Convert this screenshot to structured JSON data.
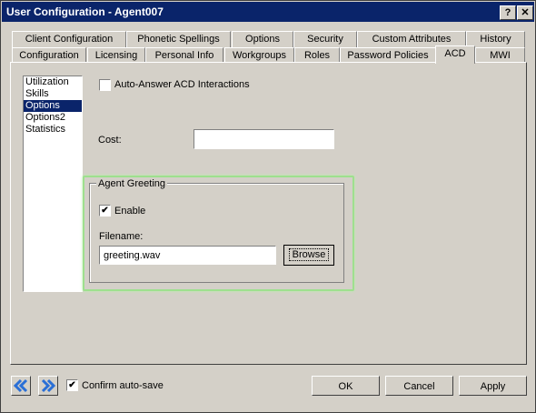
{
  "window": {
    "title": "User Configuration - Agent007",
    "help_label": "?",
    "close_label": "✕"
  },
  "tabs_row1": [
    "Client Configuration",
    "Phonetic Spellings",
    "Options",
    "Security",
    "Custom Attributes",
    "History"
  ],
  "tabs_row2": [
    "Configuration",
    "Licensing",
    "Personal Info",
    "Workgroups",
    "Roles",
    "Password Policies",
    "ACD",
    "MWI"
  ],
  "active_tab": "ACD",
  "sidebar": {
    "items": [
      "Utilization",
      "Skills",
      "Options",
      "Options2",
      "Statistics"
    ],
    "selected": "Options"
  },
  "acd_options": {
    "auto_answer_label": "Auto-Answer ACD Interactions",
    "auto_answer_checked": false,
    "cost_label": "Cost:",
    "cost_value": ""
  },
  "agent_greeting": {
    "group_label": "Agent Greeting",
    "enable_label": "Enable",
    "enable_checked": true,
    "filename_label": "Filename:",
    "filename_value": "greeting.wav",
    "browse_label": "Browse"
  },
  "footer": {
    "confirm_label": "Confirm auto-save",
    "confirm_checked": true,
    "ok_label": "OK",
    "cancel_label": "Cancel",
    "apply_label": "Apply"
  },
  "colors": {
    "titlebar": "#0a246a",
    "nav_arrow": "#2a6fd6",
    "highlight": "#9ee08e"
  }
}
